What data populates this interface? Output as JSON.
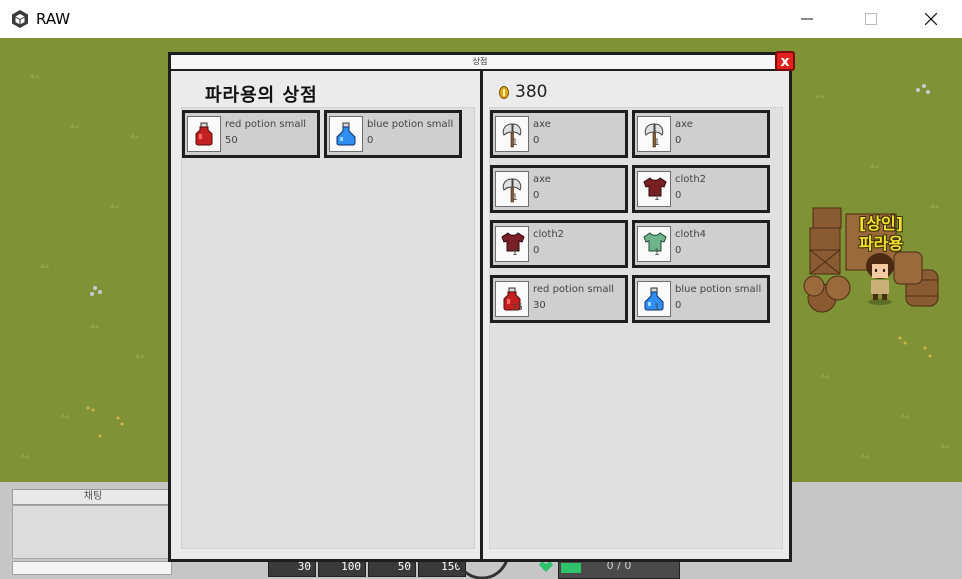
{
  "window": {
    "title": "RAW",
    "minimize_label": "—",
    "maximize_label": "☐",
    "close_label": "✕"
  },
  "shop": {
    "window_title": "상점",
    "close_label": "x",
    "shop_name": "파라용의 상점",
    "gold": "380",
    "shop_items": [
      {
        "name": "red potion small",
        "count": "50",
        "icon": "red-potion-icon"
      },
      {
        "name": "blue potion small",
        "count": "0",
        "icon": "blue-potion-icon"
      }
    ],
    "inventory_items": [
      {
        "name": "axe",
        "count": "0",
        "qty": "1",
        "icon": "axe-icon"
      },
      {
        "name": "axe",
        "count": "0",
        "qty": "1",
        "icon": "axe-icon"
      },
      {
        "name": "axe",
        "count": "0",
        "qty": "1",
        "icon": "axe-icon"
      },
      {
        "name": "cloth2",
        "count": "0",
        "qty": "1",
        "icon": "red-shirt-icon"
      },
      {
        "name": "cloth2",
        "count": "0",
        "qty": "1",
        "icon": "red-shirt-icon"
      },
      {
        "name": "cloth4",
        "count": "0",
        "qty": "1",
        "icon": "green-shirt-icon"
      },
      {
        "name": "red potion small",
        "count": "30",
        "qty": "15",
        "icon": "red-potion-icon"
      },
      {
        "name": "blue potion small",
        "count": "0",
        "qty": "1",
        "icon": "blue-potion-icon"
      }
    ]
  },
  "npc": {
    "role": "[상인]",
    "name": "파라용"
  },
  "chat": {
    "header": "채팅"
  },
  "hud": {
    "slots": [
      "30",
      "100",
      "50",
      "150"
    ],
    "hp": "0 / 0"
  },
  "colors": {
    "grass": "#7f9336",
    "panel_border": "#1e1e1e",
    "close_red": "#e4211f",
    "npc_label": "#f3e02a"
  }
}
